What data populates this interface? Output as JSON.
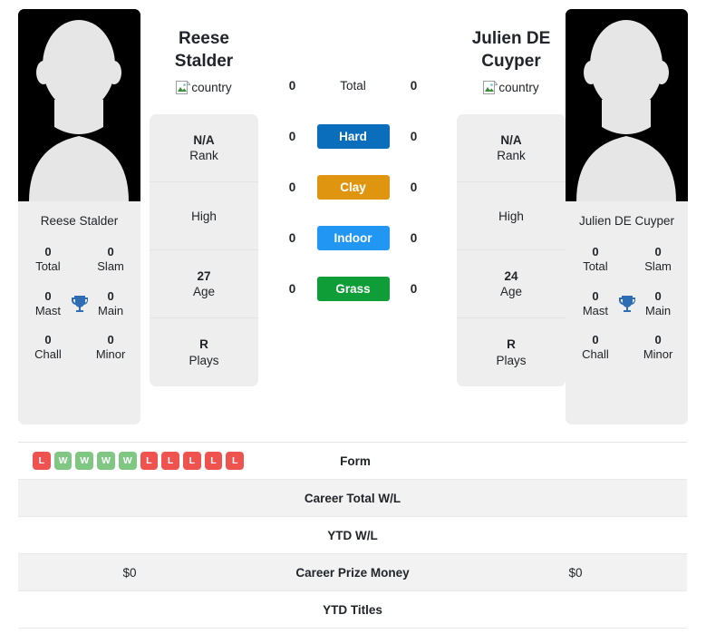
{
  "colors": {
    "hard": "#0a6ebd",
    "clay": "#e09510",
    "indoor": "#2196f3",
    "grass": "#0f9d38",
    "win": "#81c784",
    "loss": "#ef5350",
    "trophy": "#2e6db4",
    "card_bg": "#eeeeee",
    "row_alt_bg": "#f2f2f2"
  },
  "players": [
    {
      "name": "Reese Stalder",
      "photo_caption": "Reese Stalder",
      "flag_alt": "country",
      "honours": [
        {
          "value": "0",
          "label": "Total"
        },
        {
          "value": "0",
          "label": "Slam"
        },
        {
          "value": "0",
          "label": "Mast"
        },
        {
          "value": "0",
          "label": "Main"
        },
        {
          "value": "0",
          "label": "Chall"
        },
        {
          "value": "0",
          "label": "Minor"
        }
      ],
      "bio": [
        {
          "value": "N/A",
          "label": "Rank"
        },
        {
          "value": "",
          "label": "High"
        },
        {
          "value": "27",
          "label": "Age"
        },
        {
          "value": "R",
          "label": "Plays"
        }
      ]
    },
    {
      "name": "Julien DE Cuyper",
      "photo_caption": "Julien DE Cuyper",
      "flag_alt": "country",
      "honours": [
        {
          "value": "0",
          "label": "Total"
        },
        {
          "value": "0",
          "label": "Slam"
        },
        {
          "value": "0",
          "label": "Mast"
        },
        {
          "value": "0",
          "label": "Main"
        },
        {
          "value": "0",
          "label": "Chall"
        },
        {
          "value": "0",
          "label": "Minor"
        }
      ],
      "bio": [
        {
          "value": "N/A",
          "label": "Rank"
        },
        {
          "value": "",
          "label": "High"
        },
        {
          "value": "24",
          "label": "Age"
        },
        {
          "value": "R",
          "label": "Plays"
        }
      ]
    }
  ],
  "surfaces": [
    {
      "label": "Total",
      "left": "0",
      "right": "0",
      "style": "plain",
      "color": ""
    },
    {
      "label": "Hard",
      "left": "0",
      "right": "0",
      "style": "badge",
      "color": "#0a6ebd"
    },
    {
      "label": "Clay",
      "left": "0",
      "right": "0",
      "style": "badge",
      "color": "#e09510"
    },
    {
      "label": "Indoor",
      "left": "0",
      "right": "0",
      "style": "badge",
      "color": "#2196f3"
    },
    {
      "label": "Grass",
      "left": "0",
      "right": "0",
      "style": "badge",
      "color": "#0f9d38"
    }
  ],
  "table": {
    "rows": [
      {
        "label": "Form",
        "type": "form",
        "left_form": [
          "L",
          "W",
          "W",
          "W",
          "W",
          "L",
          "L",
          "L",
          "L",
          "L"
        ],
        "right_form": [],
        "left": "",
        "right": "",
        "alt": false
      },
      {
        "label": "Career Total W/L",
        "type": "text",
        "left": "",
        "right": "",
        "alt": true
      },
      {
        "label": "YTD W/L",
        "type": "text",
        "left": "",
        "right": "",
        "alt": false
      },
      {
        "label": "Career Prize Money",
        "type": "text",
        "left": "$0",
        "right": "$0",
        "alt": true
      },
      {
        "label": "YTD Titles",
        "type": "text",
        "left": "",
        "right": "",
        "alt": false
      }
    ]
  }
}
